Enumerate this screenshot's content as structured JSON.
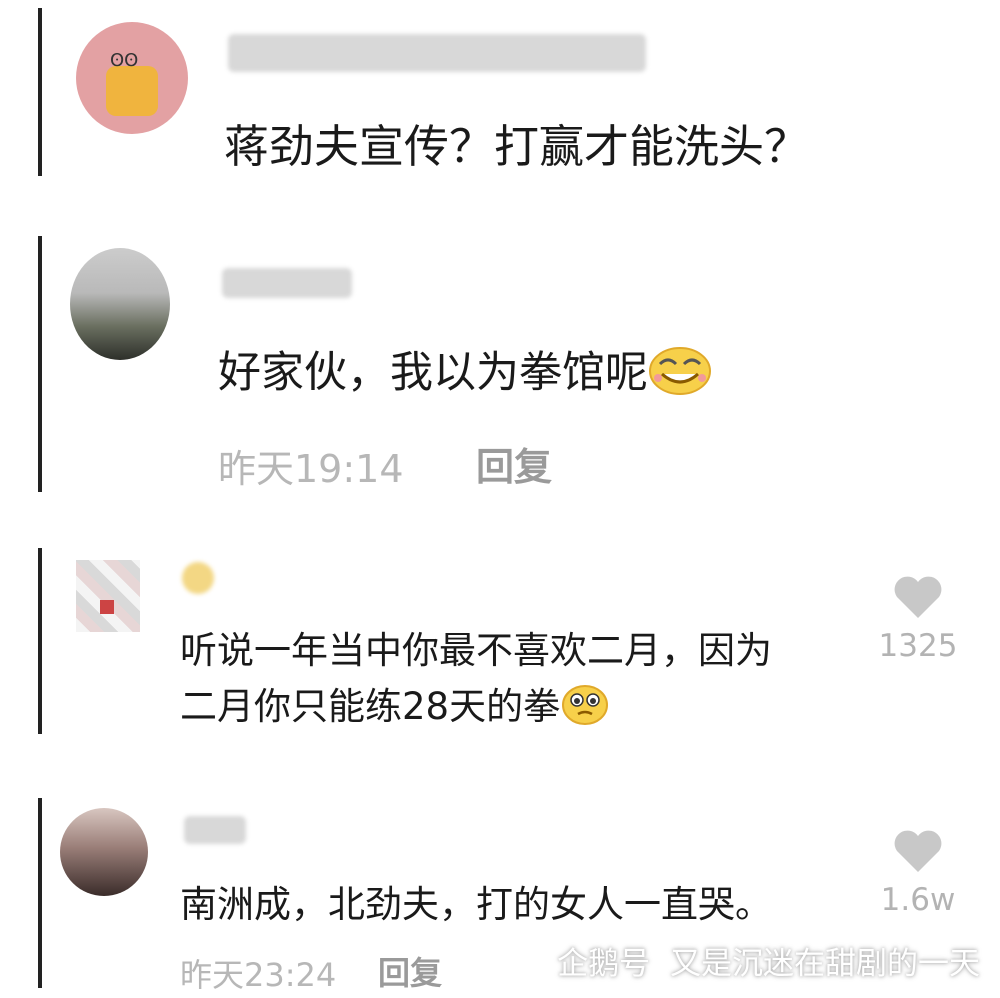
{
  "thread": [
    {
      "comment": "蒋劲夫宣传？打赢才能洗头？"
    },
    {
      "comment": "好家伙，我以为拳馆呢",
      "emoji": "laughing-emoji",
      "time": "昨天19:14",
      "reply_label": "回复"
    },
    {
      "comment_line1": "听说一年当中你最不喜欢二月，因为",
      "comment_line2": "二月你只能练28天的拳",
      "emoji": "pleading-emoji",
      "likes": "1325"
    },
    {
      "comment": "南洲成，北劲夫，打的女人一直哭。",
      "time": "昨天23:24",
      "reply_label": "回复",
      "likes": "1.6w"
    }
  ],
  "watermark": {
    "brand": "企鹅号",
    "author": "又是沉迷在甜剧的一天"
  },
  "icons": {
    "like": "heart-icon",
    "watermark_logo": "penguin-logo-icon"
  },
  "colors": {
    "text": "#1a1a1a",
    "meta": "#b7b7b7",
    "heart": "#c8c8c8"
  }
}
